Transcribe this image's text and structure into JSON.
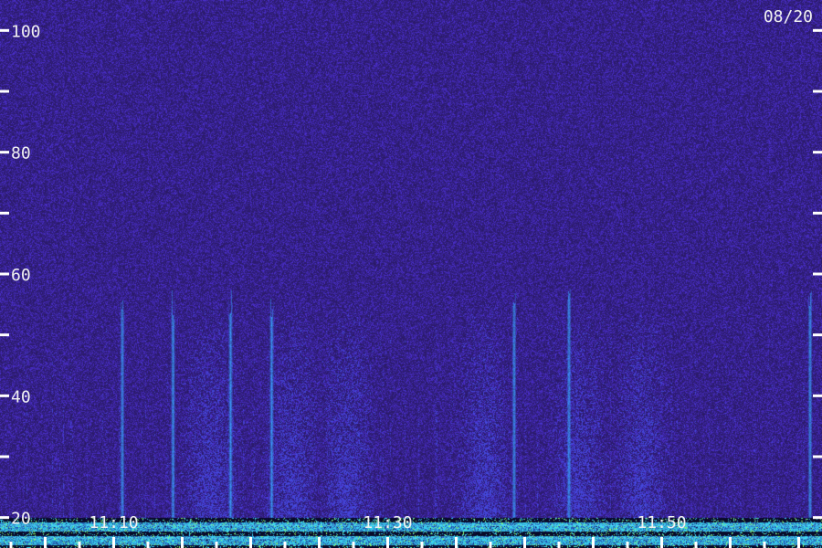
{
  "date_label": "08/20",
  "chart_data": {
    "type": "heatmap",
    "title": "",
    "xlabel": "",
    "ylabel": "",
    "ylim": [
      15,
      105
    ],
    "y_ticks_major": [
      20,
      40,
      60,
      80,
      100
    ],
    "y_ticks_minor": [
      30,
      50,
      70,
      90
    ],
    "x_ticks": [
      {
        "label": "11:10",
        "minute": 10
      },
      {
        "label": "11:30",
        "minute": 30
      },
      {
        "label": "11:50",
        "minute": 50
      }
    ],
    "x_range_minutes": [
      1.7,
      61.7
    ],
    "grid": false,
    "colors": {
      "background": "#2a1a66",
      "noise": "#4b2fcf",
      "streak": "#38a8ff",
      "low_band": "#39c9e0",
      "low_band_hot": "#8fff6a"
    },
    "features": {
      "low_band_top": 20,
      "bright_streaks_minutes": [
        10.6,
        14.3,
        18.5,
        21.5,
        39.2,
        43.2,
        60.8
      ],
      "diffuse_glow_minutes": [
        17,
        23,
        27,
        37,
        44,
        48.5
      ]
    }
  }
}
